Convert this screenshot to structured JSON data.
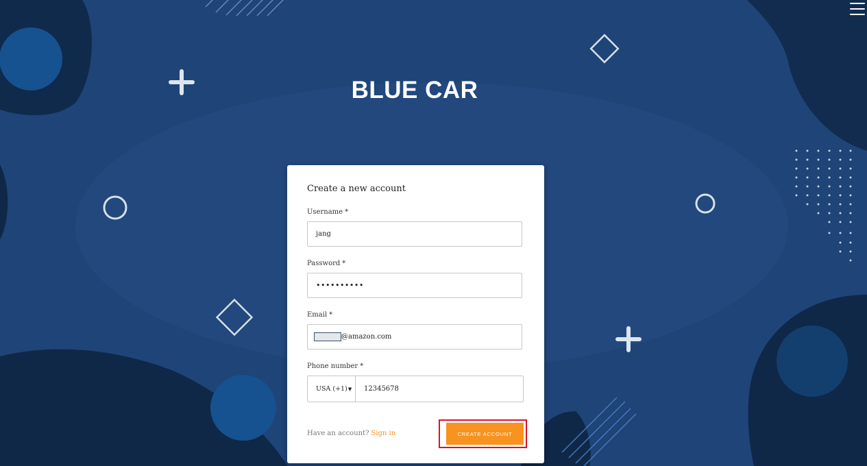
{
  "header": {
    "app_title": "BLUE CAR",
    "menu_icon": "hamburger-icon"
  },
  "form": {
    "heading": "Create a new account",
    "username": {
      "label": "Username",
      "required_mark": "*",
      "value": "jang"
    },
    "password": {
      "label": "Password",
      "required_mark": "*",
      "value": "••••••••••"
    },
    "email": {
      "label": "Email",
      "required_mark": "*",
      "value_suffix": "@amazon.com"
    },
    "phone": {
      "label": "Phone number",
      "required_mark": "*",
      "country_code": "USA (+1)",
      "value": "12345678"
    },
    "footer": {
      "prompt": "Have an account?",
      "signin_link": "Sign in"
    },
    "submit_label": "CREATE ACCOUNT"
  },
  "colors": {
    "background": "#1f4477",
    "accent": "#f7931e",
    "highlight": "#e0102a"
  }
}
